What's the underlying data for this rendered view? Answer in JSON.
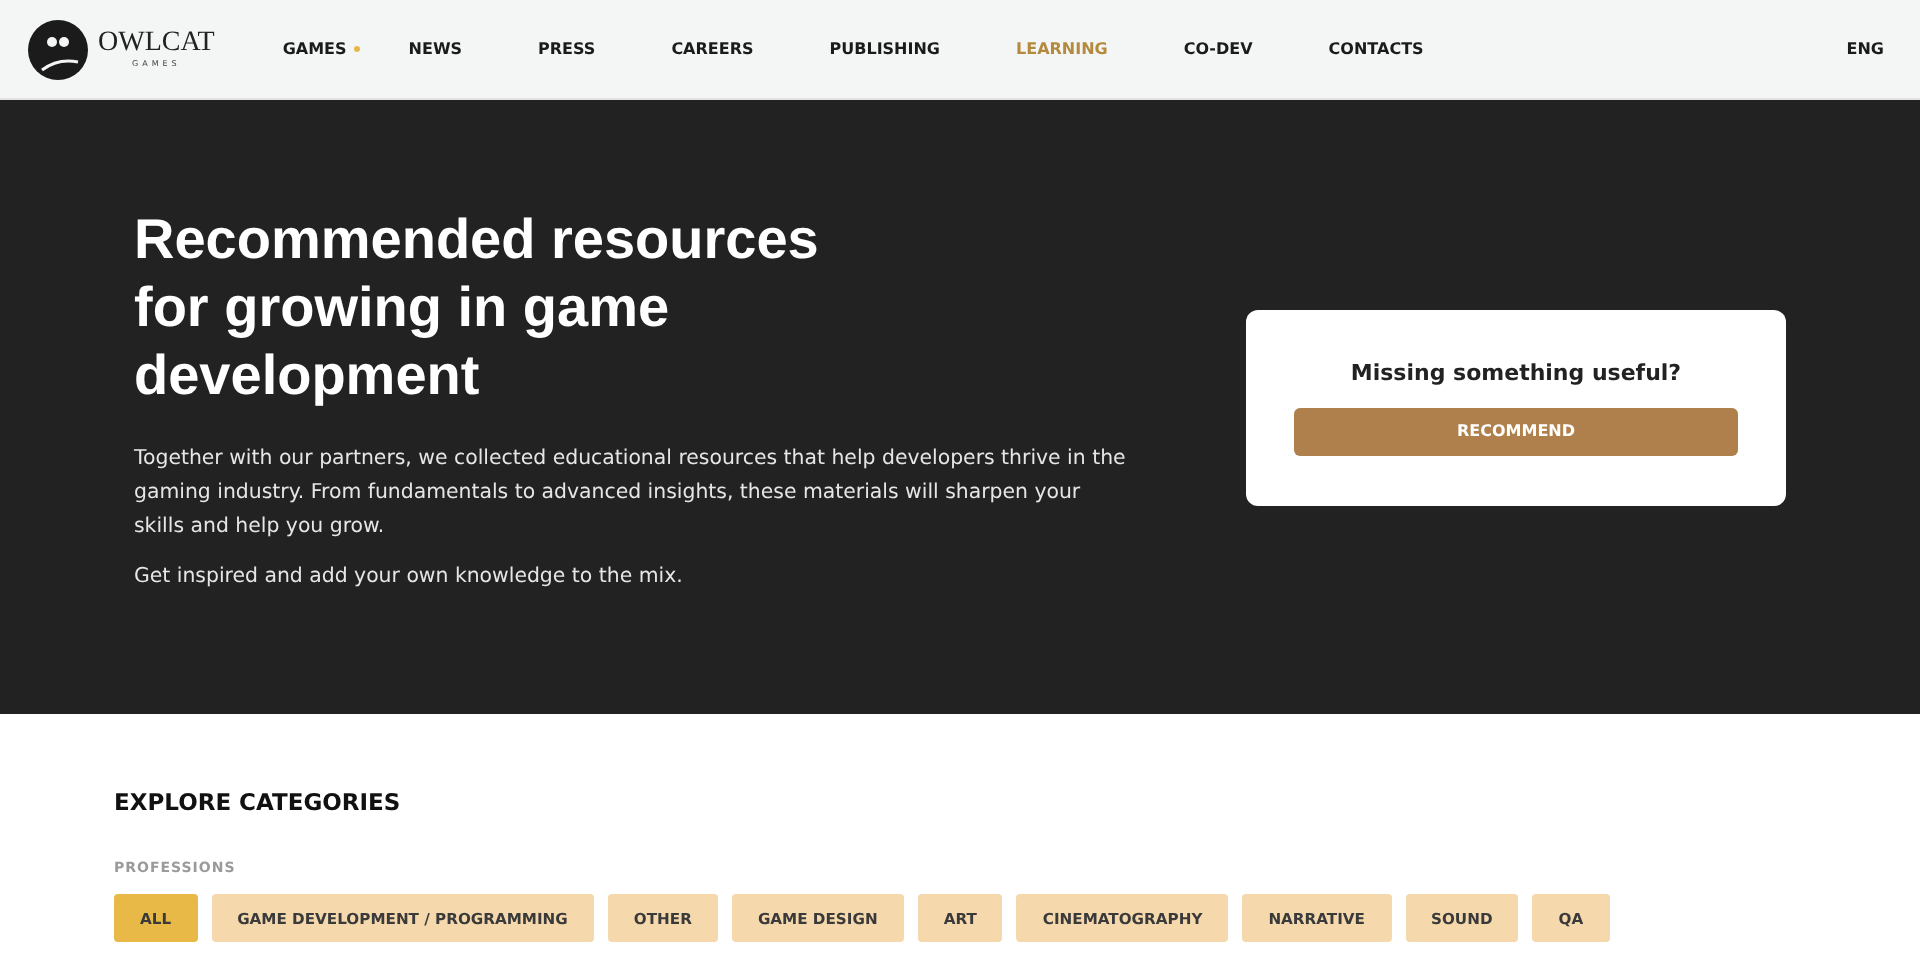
{
  "logo": {
    "name": "OWLCAT",
    "sub": "GAMES"
  },
  "nav": [
    {
      "label": "GAMES",
      "selected": false,
      "dropdown": true
    },
    {
      "label": "NEWS",
      "selected": false,
      "dropdown": false
    },
    {
      "label": "PRESS",
      "selected": false,
      "dropdown": false
    },
    {
      "label": "CAREERS",
      "selected": false,
      "dropdown": false
    },
    {
      "label": "PUBLISHING",
      "selected": false,
      "dropdown": false
    },
    {
      "label": "LEARNING",
      "selected": true,
      "dropdown": false
    },
    {
      "label": "CO-DEV",
      "selected": false,
      "dropdown": false
    },
    {
      "label": "CONTACTS",
      "selected": false,
      "dropdown": false
    }
  ],
  "language": "ENG",
  "hero": {
    "title": "Recommended resources for growing in game development",
    "paragraphs": [
      "Together with our partners, we collected educational resources that help developers thrive in the gaming industry. From fundamentals to advanced insights, these materials will sharpen your skills and help you grow.",
      "Get inspired and add your own knowledge to the mix."
    ]
  },
  "card": {
    "text": "Missing something useful?",
    "button": "RECOMMEND"
  },
  "categories": {
    "heading": "EXPLORE CATEGORIES",
    "group": "PROFESSIONS",
    "chips": [
      {
        "label": "ALL",
        "selected": true
      },
      {
        "label": "GAME DEVELOPMENT / PROGRAMMING",
        "selected": false
      },
      {
        "label": "OTHER",
        "selected": false
      },
      {
        "label": "GAME DESIGN",
        "selected": false
      },
      {
        "label": "ART",
        "selected": false
      },
      {
        "label": "CINEMATOGRAPHY",
        "selected": false
      },
      {
        "label": "NARRATIVE",
        "selected": false
      },
      {
        "label": "SOUND",
        "selected": false
      },
      {
        "label": "QA",
        "selected": false
      }
    ]
  }
}
